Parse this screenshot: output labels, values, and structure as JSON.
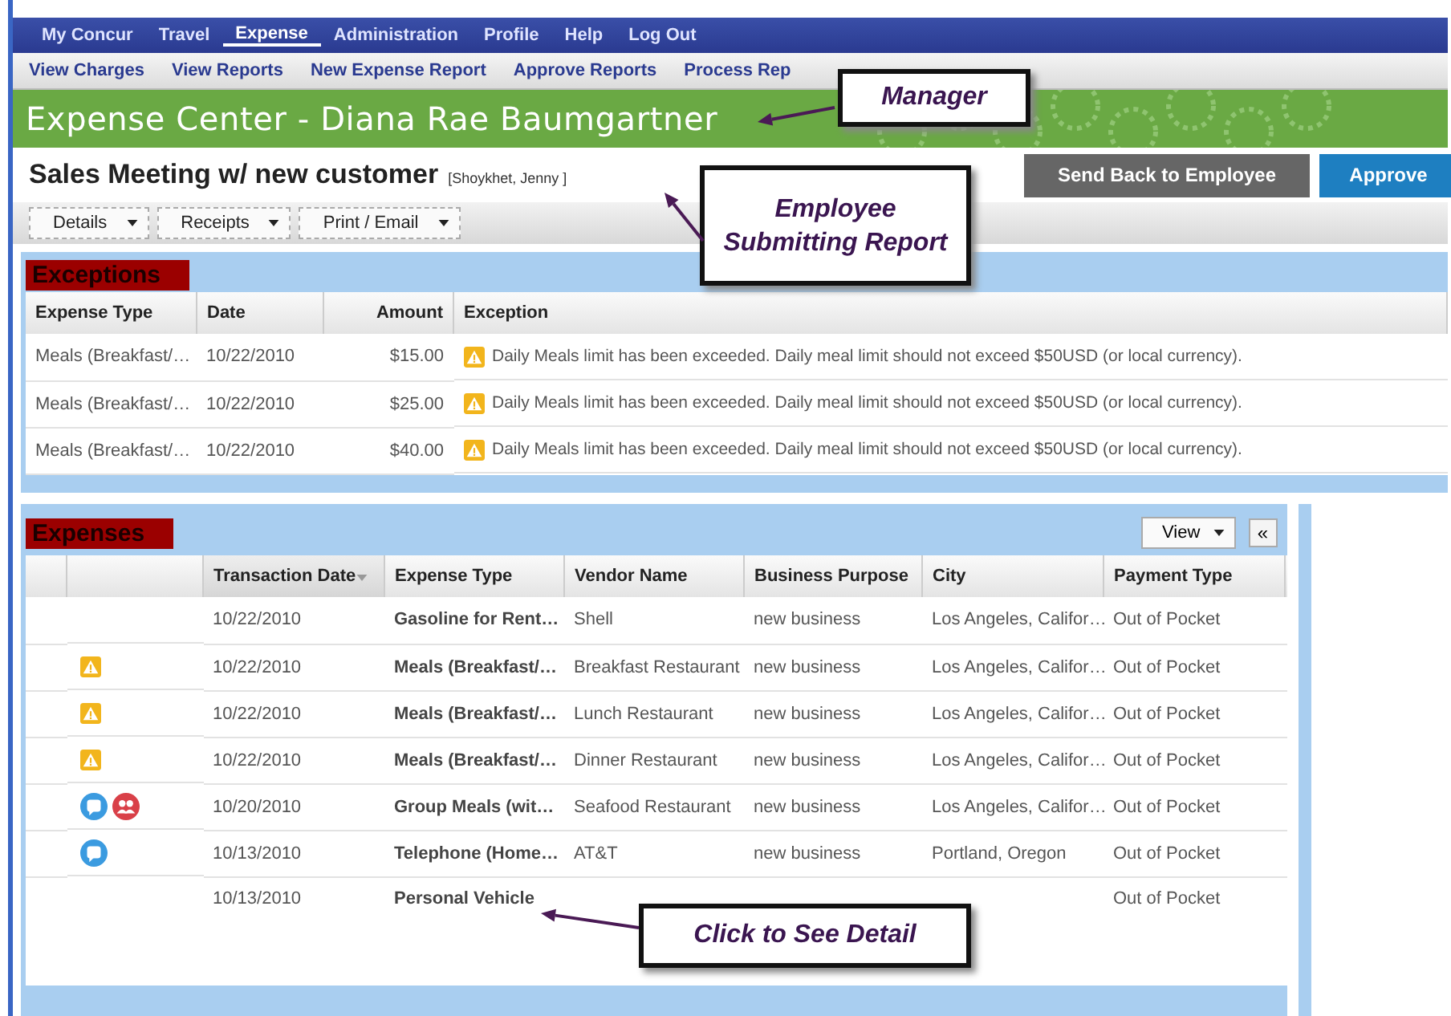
{
  "top_nav": [
    {
      "label": "My Concur",
      "selected": false
    },
    {
      "label": "Travel",
      "selected": false
    },
    {
      "label": "Expense",
      "selected": true
    },
    {
      "label": "Administration",
      "selected": false
    },
    {
      "label": "Profile",
      "selected": false
    },
    {
      "label": "Help",
      "selected": false
    },
    {
      "label": "Log Out",
      "selected": false
    }
  ],
  "sub_nav": [
    "View Charges",
    "View Reports",
    "New Expense Report",
    "Approve Reports",
    "Process Rep"
  ],
  "banner": {
    "title": "Expense Center - Diana Rae Baumgartner"
  },
  "report": {
    "title": "Sales Meeting w/ new customer",
    "employee": "[Shoykhet, Jenny ]"
  },
  "actions": [
    "Send Back to Employee",
    "Approve"
  ],
  "toolbar": [
    "Details",
    "Receipts",
    "Print / Email"
  ],
  "exceptions": {
    "heading": "Exceptions",
    "columns": [
      "Expense Type",
      "Date",
      "Amount",
      "Exception"
    ],
    "rows": [
      {
        "expense_type": "Meals (Breakfast/…",
        "date": "10/22/2010",
        "amount": "$15.00",
        "exception": "Daily Meals limit has been exceeded. Daily meal limit should not exceed $50USD (or local currency)."
      },
      {
        "expense_type": "Meals (Breakfast/…",
        "date": "10/22/2010",
        "amount": "$25.00",
        "exception": "Daily Meals limit has been exceeded. Daily meal limit should not exceed $50USD (or local currency)."
      },
      {
        "expense_type": "Meals (Breakfast/…",
        "date": "10/22/2010",
        "amount": "$40.00",
        "exception": "Daily Meals limit has been exceeded. Daily meal limit should not exceed $50USD (or local currency)."
      }
    ]
  },
  "expenses": {
    "heading": "Expenses",
    "view_button": "View",
    "collapse_button": "«",
    "columns": [
      {
        "label": "Transaction Date",
        "sorted": true
      },
      {
        "label": "Expense Type",
        "sorted": false
      },
      {
        "label": "Vendor Name",
        "sorted": false
      },
      {
        "label": "Business Purpose",
        "sorted": false
      },
      {
        "label": "City",
        "sorted": false
      },
      {
        "label": "Payment Type",
        "sorted": false
      }
    ],
    "rows": [
      {
        "has_exception": false,
        "has_comment": false,
        "has_attendees": false,
        "date": "10/22/2010",
        "expense_type": "Gasoline for Rent…",
        "vendor": "Shell",
        "purpose": "new business",
        "city": "Los Angeles, Califor…",
        "payment": "Out of Pocket"
      },
      {
        "has_exception": true,
        "has_comment": false,
        "has_attendees": false,
        "date": "10/22/2010",
        "expense_type": "Meals (Breakfast/…",
        "vendor": "Breakfast Restaurant",
        "purpose": "new business",
        "city": "Los Angeles, Califor…",
        "payment": "Out of Pocket"
      },
      {
        "has_exception": true,
        "has_comment": false,
        "has_attendees": false,
        "date": "10/22/2010",
        "expense_type": "Meals (Breakfast/…",
        "vendor": "Lunch Restaurant",
        "purpose": "new business",
        "city": "Los Angeles, Califor…",
        "payment": "Out of Pocket"
      },
      {
        "has_exception": true,
        "has_comment": false,
        "has_attendees": false,
        "date": "10/22/2010",
        "expense_type": "Meals (Breakfast/…",
        "vendor": "Dinner Restaurant",
        "purpose": "new business",
        "city": "Los Angeles, Califor…",
        "payment": "Out of Pocket"
      },
      {
        "has_exception": false,
        "has_comment": true,
        "has_attendees": true,
        "date": "10/20/2010",
        "expense_type": "Group Meals (wit…",
        "vendor": "Seafood Restaurant",
        "purpose": "new business",
        "city": "Los Angeles, Califor…",
        "payment": "Out of Pocket"
      },
      {
        "has_exception": false,
        "has_comment": true,
        "has_attendees": false,
        "date": "10/13/2010",
        "expense_type": "Telephone (Home…",
        "vendor": "AT&T",
        "purpose": "new business",
        "city": "Portland, Oregon",
        "payment": "Out of Pocket"
      },
      {
        "has_exception": false,
        "has_comment": false,
        "has_attendees": false,
        "date": "10/13/2010",
        "expense_type": "Personal Vehicle",
        "vendor": "",
        "purpose": "",
        "city": "",
        "payment": "Out of Pocket"
      }
    ]
  },
  "callouts": [
    "Manager",
    "Employee Submitting Report",
    "Click to See Detail"
  ]
}
